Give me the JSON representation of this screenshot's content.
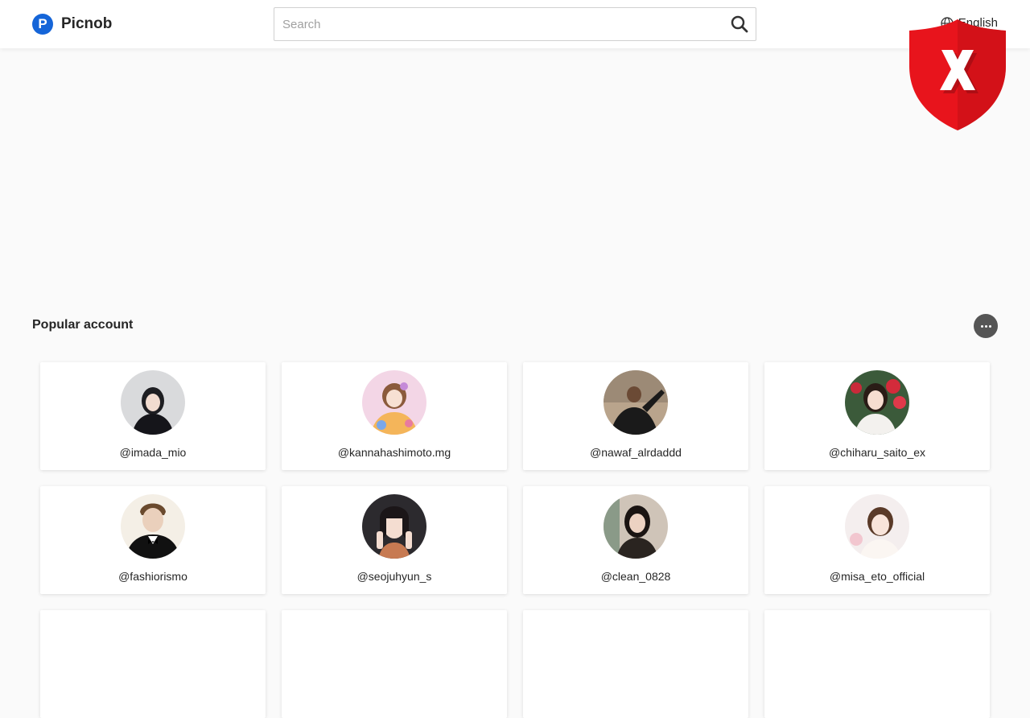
{
  "brand": {
    "logo_letter": "P",
    "name": "Picnob",
    "color": "#1565d8"
  },
  "search": {
    "placeholder": "Search",
    "value": ""
  },
  "language": {
    "label": "English"
  },
  "section": {
    "title": "Popular account"
  },
  "accounts": [
    {
      "handle": "@imada_mio"
    },
    {
      "handle": "@kannahashimoto.mg"
    },
    {
      "handle": "@nawaf_alrdaddd"
    },
    {
      "handle": "@chiharu_saito_ex"
    },
    {
      "handle": "@fashiorismo"
    },
    {
      "handle": "@seojuhyun_s"
    },
    {
      "handle": "@clean_0828"
    },
    {
      "handle": "@misa_eto_official"
    }
  ],
  "overlay": {
    "badge": "X",
    "color": "#e8141c"
  }
}
